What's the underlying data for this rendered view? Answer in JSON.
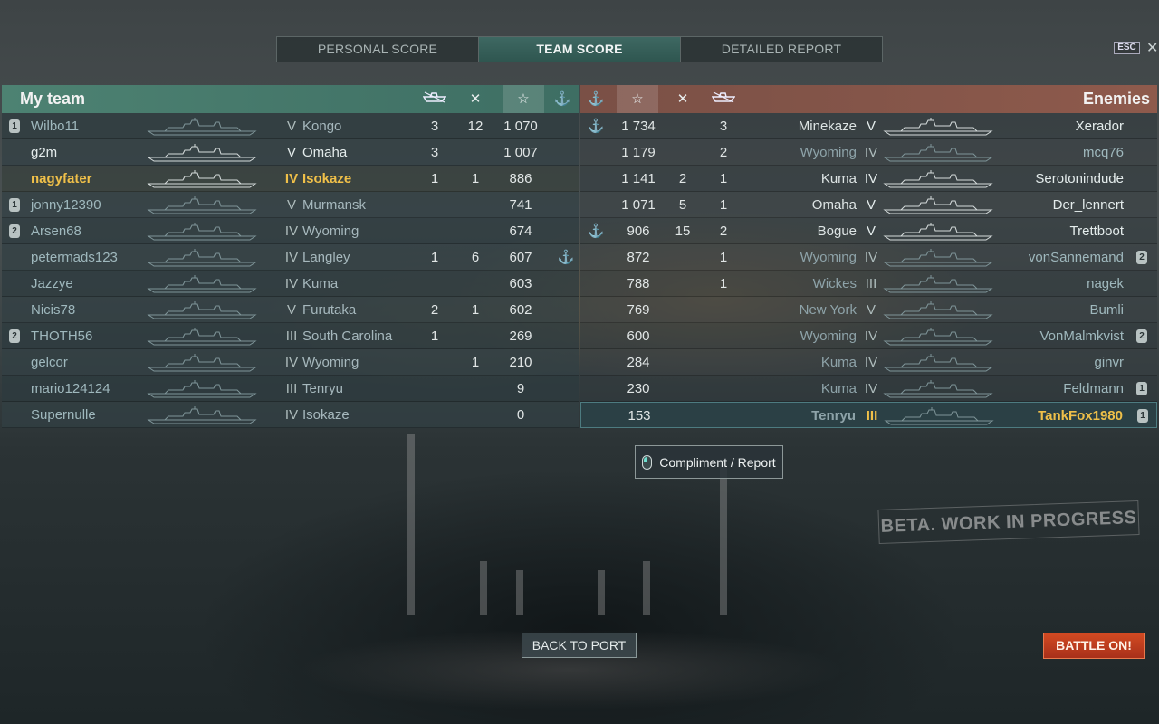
{
  "tabs": [
    {
      "label": "PERSONAL SCORE",
      "active": false
    },
    {
      "label": "TEAM SCORE",
      "active": true
    },
    {
      "label": "DETAILED REPORT",
      "active": false
    }
  ],
  "esc_label": "ESC",
  "close_glyph": "✕",
  "my_team": {
    "title": "My team",
    "header_icons": [
      "ships-destroyed-icon",
      "base-capture-icon",
      "experience-star-icon",
      "anchor-icon"
    ],
    "rows": [
      {
        "player": "Wilbo11",
        "badge": "1",
        "tier": "V",
        "ship": "Kongo",
        "kills": "3",
        "cap": "12",
        "xp": "1 070",
        "anchor": "",
        "alive": false,
        "me": false
      },
      {
        "player": "g2m",
        "badge": "",
        "tier": "V",
        "ship": "Omaha",
        "kills": "3",
        "cap": "",
        "xp": "1 007",
        "anchor": "",
        "alive": true,
        "me": false
      },
      {
        "player": "nagyfater",
        "badge": "",
        "tier": "IV",
        "ship": "Isokaze",
        "kills": "1",
        "cap": "1",
        "xp": "886",
        "anchor": "",
        "alive": true,
        "me": true
      },
      {
        "player": "jonny12390",
        "badge": "1",
        "tier": "V",
        "ship": "Murmansk",
        "kills": "",
        "cap": "",
        "xp": "741",
        "anchor": "",
        "alive": false,
        "me": false
      },
      {
        "player": "Arsen68",
        "badge": "2",
        "tier": "IV",
        "ship": "Wyoming",
        "kills": "",
        "cap": "",
        "xp": "674",
        "anchor": "",
        "alive": false,
        "me": false
      },
      {
        "player": "petermads123",
        "badge": "",
        "tier": "IV",
        "ship": "Langley",
        "kills": "1",
        "cap": "6",
        "xp": "607",
        "anchor": "⚓",
        "alive": false,
        "me": false
      },
      {
        "player": "Jazzye",
        "badge": "",
        "tier": "IV",
        "ship": "Kuma",
        "kills": "",
        "cap": "",
        "xp": "603",
        "anchor": "",
        "alive": false,
        "me": false
      },
      {
        "player": "Nicis78",
        "badge": "",
        "tier": "V",
        "ship": "Furutaka",
        "kills": "2",
        "cap": "1",
        "xp": "602",
        "anchor": "",
        "alive": false,
        "me": false
      },
      {
        "player": "THOTH56",
        "badge": "2",
        "tier": "III",
        "ship": "South Carolina",
        "kills": "1",
        "cap": "",
        "xp": "269",
        "anchor": "",
        "alive": false,
        "me": false
      },
      {
        "player": "gelcor",
        "badge": "",
        "tier": "IV",
        "ship": "Wyoming",
        "kills": "",
        "cap": "1",
        "xp": "210",
        "anchor": "",
        "alive": false,
        "me": false
      },
      {
        "player": "mario124124",
        "badge": "",
        "tier": "III",
        "ship": "Tenryu",
        "kills": "",
        "cap": "",
        "xp": "9",
        "anchor": "",
        "alive": false,
        "me": false
      },
      {
        "player": "Supernulle",
        "badge": "",
        "tier": "IV",
        "ship": "Isokaze",
        "kills": "",
        "cap": "",
        "xp": "0",
        "anchor": "",
        "alive": false,
        "me": false
      }
    ]
  },
  "enemies": {
    "title": "Enemies",
    "header_icons": [
      "anchor-icon",
      "experience-star-icon",
      "base-capture-icon",
      "ships-destroyed-icon"
    ],
    "rows": [
      {
        "player": "Xerador",
        "badge": "",
        "tier": "V",
        "ship": "Minekaze",
        "kills": "3",
        "cap": "",
        "xp": "1 734",
        "anchor": "⚓",
        "alive": true,
        "me": false
      },
      {
        "player": "mcq76",
        "badge": "",
        "tier": "IV",
        "ship": "Wyoming",
        "kills": "2",
        "cap": "",
        "xp": "1 179",
        "anchor": "",
        "alive": false,
        "me": false
      },
      {
        "player": "Serotonindude",
        "badge": "",
        "tier": "IV",
        "ship": "Kuma",
        "kills": "1",
        "cap": "2",
        "xp": "1 141",
        "anchor": "",
        "alive": true,
        "me": false
      },
      {
        "player": "Der_lennert",
        "badge": "",
        "tier": "V",
        "ship": "Omaha",
        "kills": "1",
        "cap": "5",
        "xp": "1 071",
        "anchor": "",
        "alive": true,
        "me": false
      },
      {
        "player": "Trettboot",
        "badge": "",
        "tier": "V",
        "ship": "Bogue",
        "kills": "2",
        "cap": "15",
        "xp": "906",
        "anchor": "⚓",
        "alive": true,
        "me": false
      },
      {
        "player": "vonSannemand",
        "badge": "2",
        "tier": "IV",
        "ship": "Wyoming",
        "kills": "1",
        "cap": "",
        "xp": "872",
        "anchor": "",
        "alive": false,
        "me": false
      },
      {
        "player": "nagek",
        "badge": "",
        "tier": "III",
        "ship": "Wickes",
        "kills": "1",
        "cap": "",
        "xp": "788",
        "anchor": "",
        "alive": false,
        "me": false
      },
      {
        "player": "Bumli",
        "badge": "",
        "tier": "V",
        "ship": "New York",
        "kills": "",
        "cap": "",
        "xp": "769",
        "anchor": "",
        "alive": false,
        "me": false
      },
      {
        "player": "VonMalmkvist",
        "badge": "2",
        "tier": "IV",
        "ship": "Wyoming",
        "kills": "",
        "cap": "",
        "xp": "600",
        "anchor": "",
        "alive": false,
        "me": false
      },
      {
        "player": "ginvr",
        "badge": "",
        "tier": "IV",
        "ship": "Kuma",
        "kills": "",
        "cap": "",
        "xp": "284",
        "anchor": "",
        "alive": false,
        "me": false
      },
      {
        "player": "Feldmann",
        "badge": "1",
        "tier": "IV",
        "ship": "Kuma",
        "kills": "",
        "cap": "",
        "xp": "230",
        "anchor": "",
        "alive": false,
        "me": false
      },
      {
        "player": "TankFox1980",
        "badge": "1",
        "tier": "III",
        "ship": "Tenryu",
        "kills": "",
        "cap": "",
        "xp": "153",
        "anchor": "",
        "alive": false,
        "me": false,
        "selected": true
      }
    ]
  },
  "compliment_label": "Compliment / Report",
  "watermark": "BETA. WORK IN PROGRESS",
  "back_to_port_label": "BACK TO PORT",
  "battle_on_label": "BATTLE ON!",
  "colors": {
    "my_team_header": "#4d8272",
    "enemy_header": "#8e5a4c",
    "player_highlight": "#f0c049",
    "battle_button": "#c23f1f"
  }
}
